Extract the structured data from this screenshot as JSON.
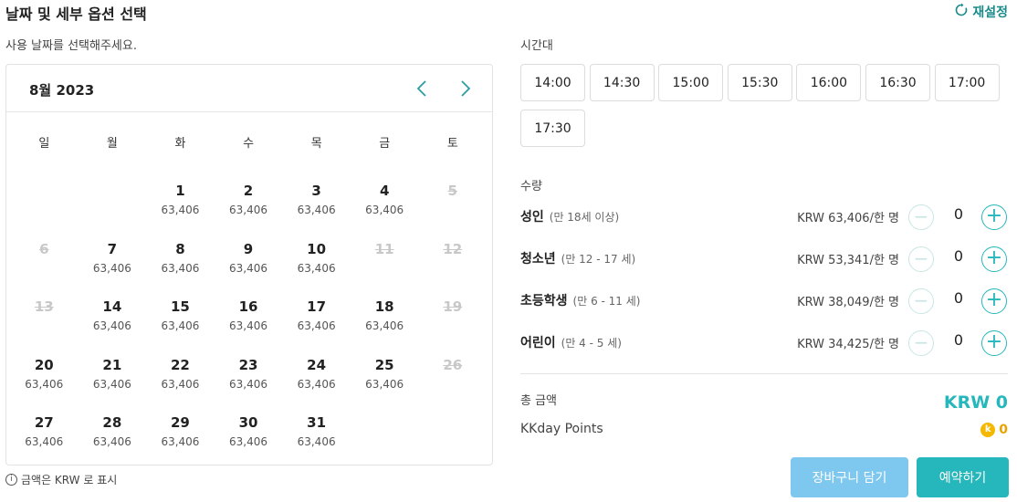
{
  "header": {
    "title": "날짜 및 세부 옵션 선택",
    "reset_label": "재설정"
  },
  "calendar": {
    "instruction": "사용 날짜를 선택해주세요.",
    "month_label": "8월 2023",
    "weekdays": [
      "일",
      "월",
      "화",
      "수",
      "목",
      "금",
      "토"
    ],
    "weeks": [
      [
        {
          "num": "",
          "price": ""
        },
        {
          "num": "",
          "price": ""
        },
        {
          "num": "1",
          "price": "63,406"
        },
        {
          "num": "2",
          "price": "63,406"
        },
        {
          "num": "3",
          "price": "63,406"
        },
        {
          "num": "4",
          "price": "63,406"
        },
        {
          "num": "5",
          "price": "",
          "disabled": true
        }
      ],
      [
        {
          "num": "6",
          "price": "",
          "disabled": true
        },
        {
          "num": "7",
          "price": "63,406"
        },
        {
          "num": "8",
          "price": "63,406"
        },
        {
          "num": "9",
          "price": "63,406"
        },
        {
          "num": "10",
          "price": "63,406"
        },
        {
          "num": "11",
          "price": "",
          "disabled": true
        },
        {
          "num": "12",
          "price": "",
          "disabled": true
        }
      ],
      [
        {
          "num": "13",
          "price": "",
          "disabled": true
        },
        {
          "num": "14",
          "price": "63,406"
        },
        {
          "num": "15",
          "price": "63,406"
        },
        {
          "num": "16",
          "price": "63,406"
        },
        {
          "num": "17",
          "price": "63,406"
        },
        {
          "num": "18",
          "price": "63,406"
        },
        {
          "num": "19",
          "price": "",
          "disabled": true
        }
      ],
      [
        {
          "num": "20",
          "price": "63,406"
        },
        {
          "num": "21",
          "price": "63,406"
        },
        {
          "num": "22",
          "price": "63,406"
        },
        {
          "num": "23",
          "price": "63,406"
        },
        {
          "num": "24",
          "price": "63,406"
        },
        {
          "num": "25",
          "price": "63,406"
        },
        {
          "num": "26",
          "price": "",
          "disabled": true
        }
      ],
      [
        {
          "num": "27",
          "price": "63,406"
        },
        {
          "num": "28",
          "price": "63,406"
        },
        {
          "num": "29",
          "price": "63,406"
        },
        {
          "num": "30",
          "price": "63,406"
        },
        {
          "num": "31",
          "price": "63,406"
        },
        {
          "num": "",
          "price": ""
        },
        {
          "num": "",
          "price": ""
        }
      ]
    ],
    "currency_note": "금액은 KRW 로 표시"
  },
  "time": {
    "label": "시간대",
    "slots": [
      "14:00",
      "14:30",
      "15:00",
      "15:30",
      "16:00",
      "16:30",
      "17:00",
      "17:30"
    ]
  },
  "quantity": {
    "label": "수량",
    "rows": [
      {
        "name": "성인",
        "age": "(만 18세 이상)",
        "price": "KRW 63,406/한 명",
        "count": "0"
      },
      {
        "name": "청소년",
        "age": "(만 12 - 17 세)",
        "price": "KRW 53,341/한 명",
        "count": "0"
      },
      {
        "name": "초등학생",
        "age": "(만 6 - 11 세)",
        "price": "KRW 38,049/한 명",
        "count": "0"
      },
      {
        "name": "어린이",
        "age": "(만 4 - 5 세)",
        "price": "KRW 34,425/한 명",
        "count": "0"
      }
    ]
  },
  "summary": {
    "total_label": "총 금액",
    "total_value": "KRW 0",
    "points_label": "KKday Points",
    "points_value": "0",
    "coin_glyph": "k"
  },
  "actions": {
    "cart_label": "장바구니 담기",
    "book_label": "예약하기"
  },
  "colors": {
    "accent": "#26b7bc",
    "cart": "#7ec8f0",
    "points": "#f5b800",
    "reset": "#1a8a8a"
  }
}
